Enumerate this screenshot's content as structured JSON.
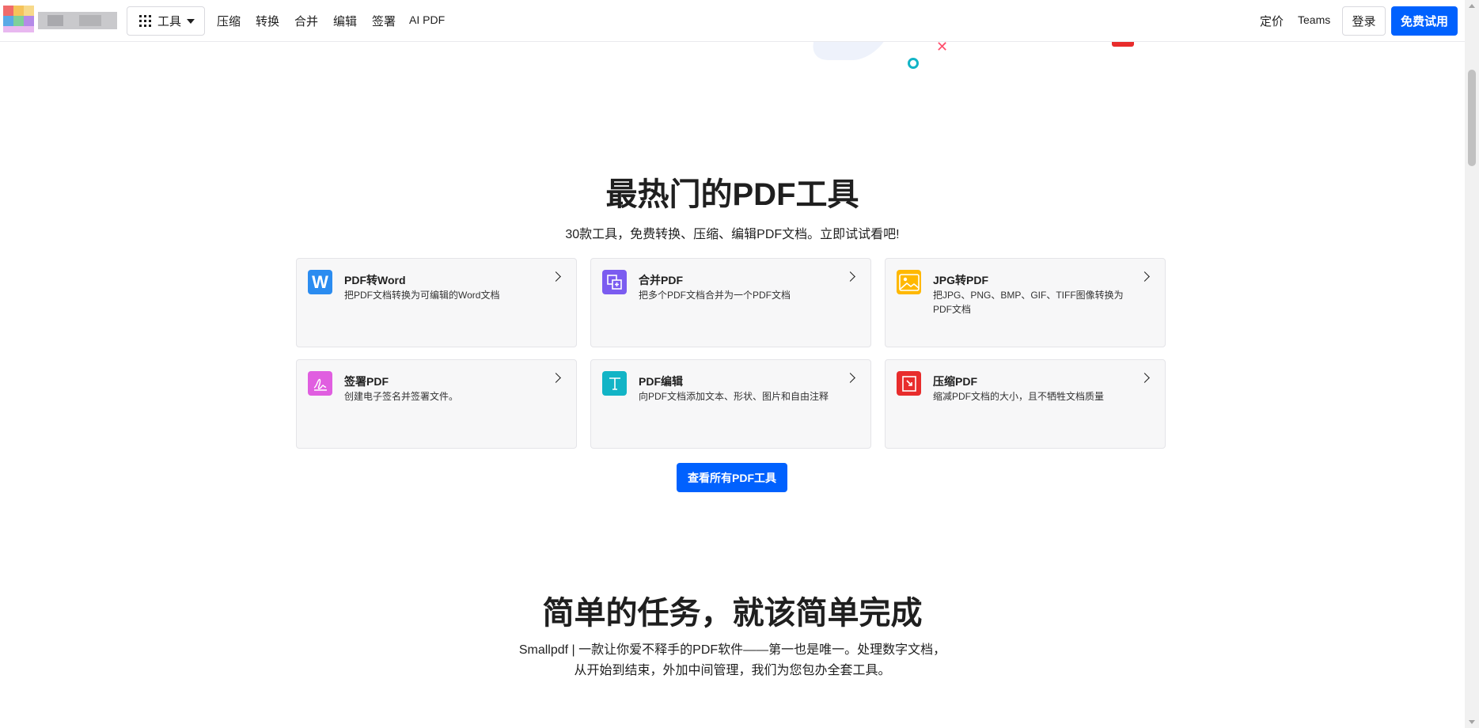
{
  "nav": {
    "tools_label": "工具",
    "links": [
      "压缩",
      "转换",
      "合并",
      "编辑",
      "签署",
      "AI PDF"
    ],
    "pricing": "定价",
    "teams": "Teams",
    "login": "登录",
    "trial": "免费试用"
  },
  "popular": {
    "title": "最热门的PDF工具",
    "subtitle": "30款工具，免费转换、压缩、编辑PDF文档。立即试试看吧!",
    "cards": [
      {
        "title": "PDF转Word",
        "desc": "把PDF文档转换为可编辑的Word文档",
        "icon": "word-icon",
        "color": "#2b8cf0"
      },
      {
        "title": "合并PDF",
        "desc": "把多个PDF文档合并为一个PDF文档",
        "icon": "merge-icon",
        "color": "#7b5cf0"
      },
      {
        "title": "JPG转PDF",
        "desc": "把JPG、PNG、BMP、GIF、TIFF图像转换为PDF文档",
        "icon": "image-icon",
        "color": "#ffb800"
      },
      {
        "title": "签署PDF",
        "desc": "创建电子签名并签署文件。",
        "icon": "signature-icon",
        "color": "#e05ee0"
      },
      {
        "title": "PDF编辑",
        "desc": "向PDF文档添加文本、形状、图片和自由注释",
        "icon": "text-edit-icon",
        "color": "#12b4c6"
      },
      {
        "title": "压缩PDF",
        "desc": "缩减PDF文档的大小，且不牺牲文档质量",
        "icon": "compress-icon",
        "color": "#e82c2c"
      }
    ],
    "all_button": "查看所有PDF工具"
  },
  "simple": {
    "title": "简单的任务，就该简单完成",
    "line1": "Smallpdf | 一款让你爱不释手的PDF软件——第一也是唯一。处理数字文档，",
    "line2": "从开始到结束，外加中间管理，我们为您包办全套工具。"
  },
  "colors": {
    "accent": "#0061fe"
  }
}
